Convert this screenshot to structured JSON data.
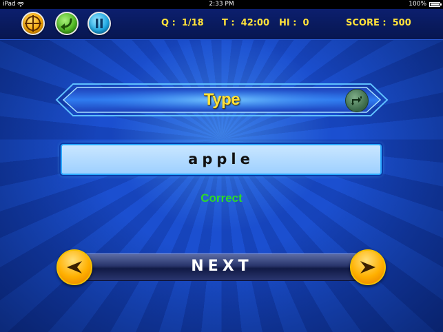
{
  "status_bar": {
    "device": "iPad",
    "time": "2:33 PM",
    "battery": "100%"
  },
  "hud": {
    "q_label": "Q :  1/18",
    "t_label": "T :  42:00",
    "hi_label": "HI :  0",
    "score_label": "SCORE :  500",
    "buttons": [
      "target-icon",
      "undo-arrow-icon",
      "pause-icon"
    ]
  },
  "banner": {
    "title": "Type"
  },
  "answer": {
    "text": "apple"
  },
  "result": {
    "text": "Correct"
  },
  "nav": {
    "next_label": "NEXT"
  },
  "colors": {
    "hud_text": "#ffe23a",
    "correct": "#2bd92b",
    "background": "#1a4fcf"
  }
}
